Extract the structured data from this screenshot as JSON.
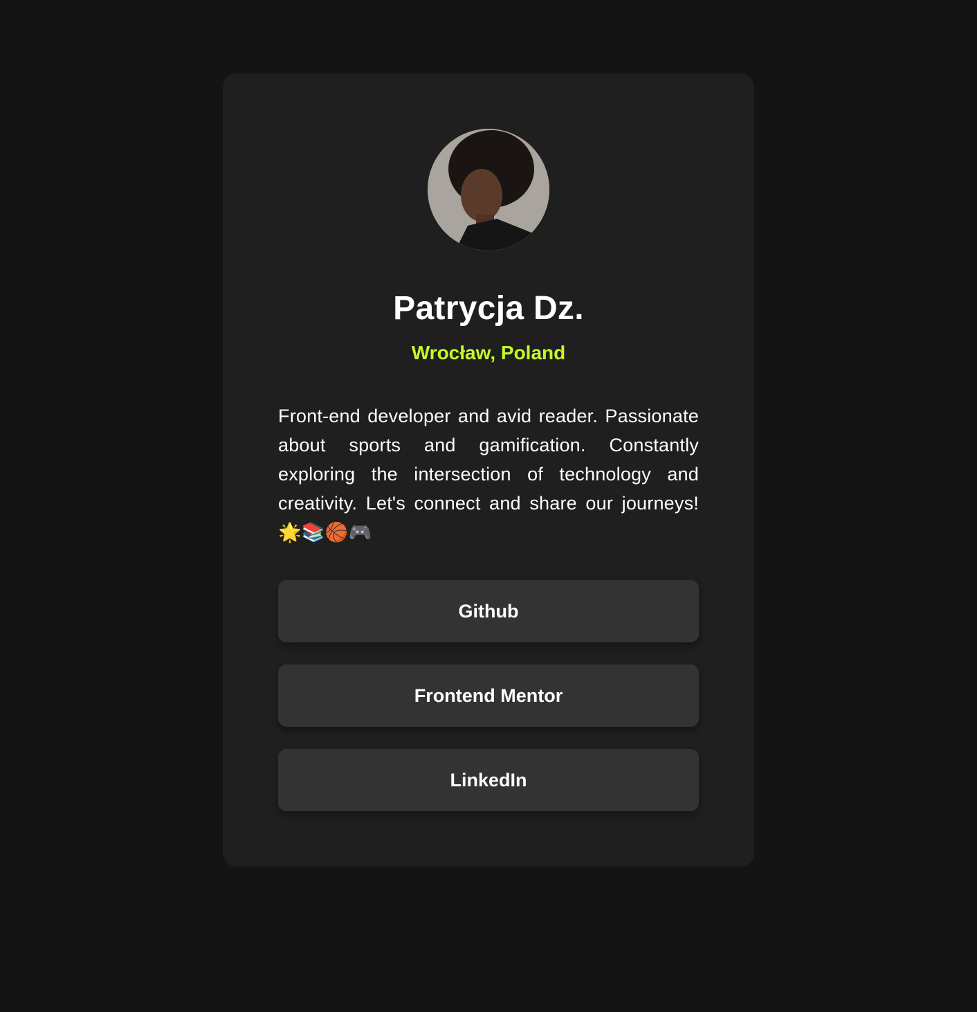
{
  "profile": {
    "name": "Patrycja Dz.",
    "location": "Wrocław, Poland",
    "bio": "Front-end developer and avid reader. Passionate about sports and gamification. Constantly exploring the intersection of technology and creativity. Let's connect and share our journeys! 🌟📚🏀🎮",
    "avatar_icon": "profile-photo"
  },
  "links": [
    {
      "label": "Github"
    },
    {
      "label": "Frontend Mentor"
    },
    {
      "label": "LinkedIn"
    }
  ],
  "colors": {
    "page_background": "#141414",
    "card_background": "#1f1f1f",
    "button_background": "#333333",
    "accent": "#c4f82a",
    "text": "#ffffff"
  }
}
